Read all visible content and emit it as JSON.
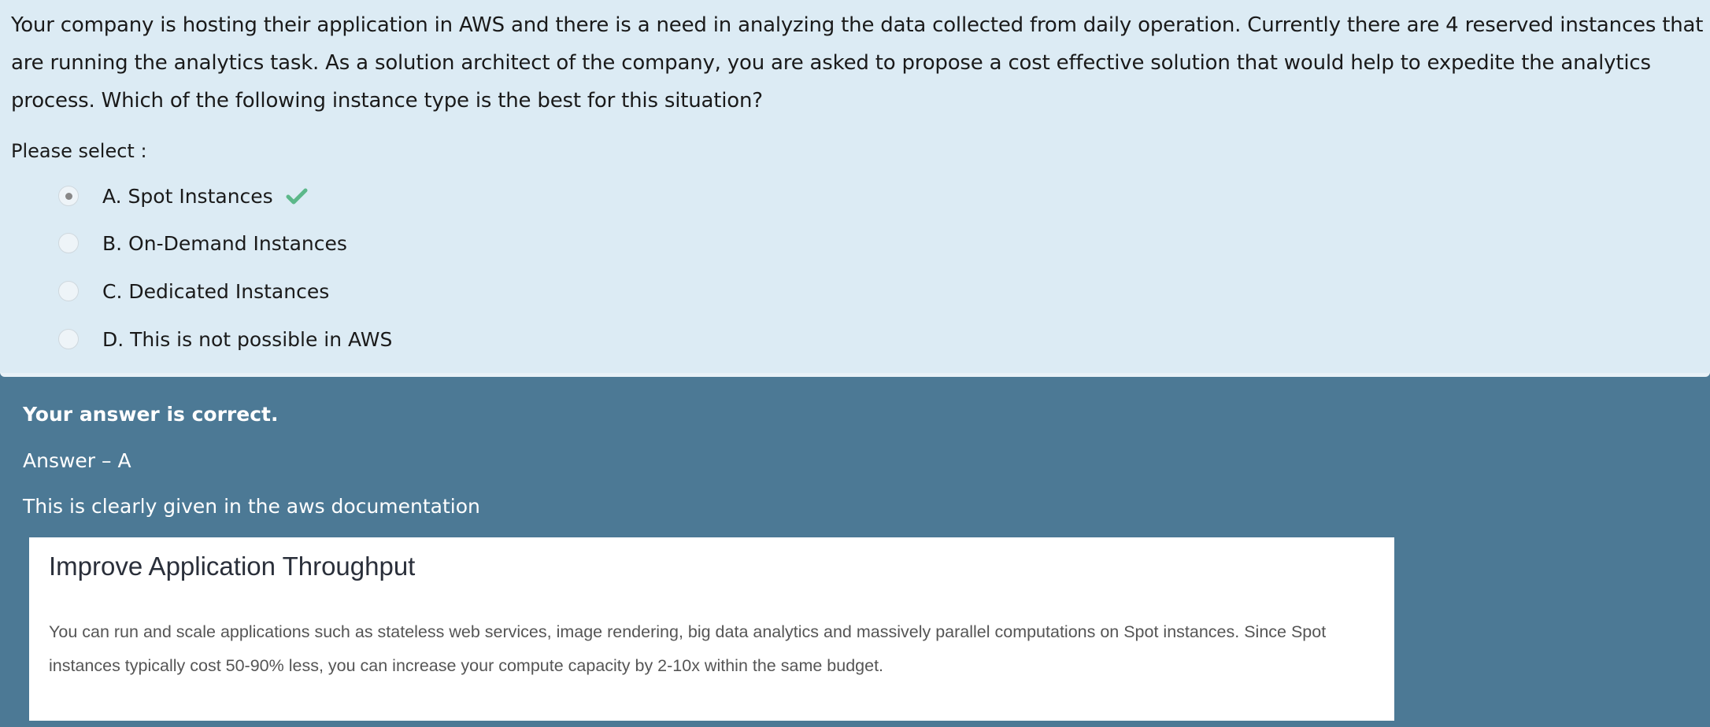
{
  "question": {
    "text": "Your company is hosting their application in AWS and there is a need in analyzing the data collected from daily operation. Currently there are 4 reserved instances that are running the analytics task. As a solution architect of the company, you are asked to propose a cost effective solution that would help to expedite the analytics process. Which of the following instance type is the best for this situation?",
    "prompt": "Please select :",
    "options": [
      {
        "label": "A. Spot Instances",
        "selected": true,
        "correct": true
      },
      {
        "label": "B. On-Demand Instances",
        "selected": false
      },
      {
        "label": "C. Dedicated Instances",
        "selected": false
      },
      {
        "label": "D. This is not possible in AWS",
        "selected": false
      }
    ]
  },
  "feedback": {
    "status": "Your answer is correct.",
    "answer": "Answer – A",
    "explanation": "This is clearly given in the aws documentation",
    "doc_excerpt": {
      "heading": "Improve Application Throughput",
      "body": "You can run and scale applications such as stateless web services, image rendering, big data analytics and massively parallel computations on Spot instances. Since Spot instances typically cost 50-90% less, you can increase your compute capacity by 2-10x within the same budget."
    }
  },
  "colors": {
    "question_bg": "#dcebf4",
    "feedback_bg": "#4c7995",
    "check": "#5cb88a"
  }
}
